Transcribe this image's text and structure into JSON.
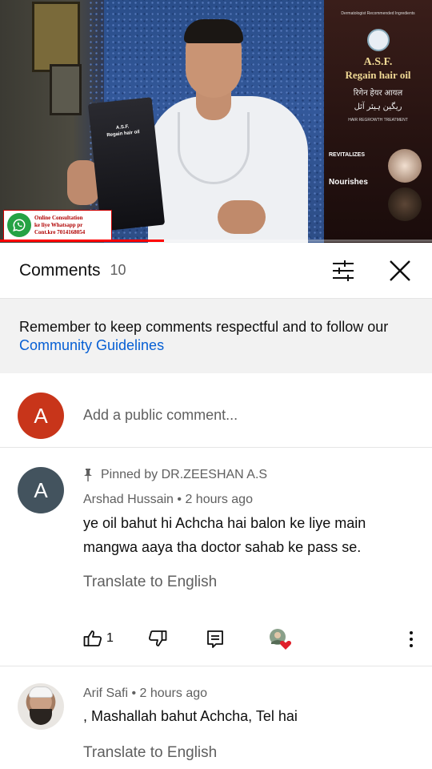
{
  "video": {
    "product_tag": "Dermatologist Recommended Ingredients",
    "product_title": "A.S.F.",
    "product_subtitle": "Regain hair oil",
    "product_hindi": "रिगेन हेयर आयल",
    "product_urdu": "ریگین ہیئر آئل",
    "product_small": "HAIR REGROWTH TREATMENT",
    "product_revitalizes": "REVITALIZES",
    "product_nourishes": "Nourishes",
    "bottle_lines": [
      "A.S.F.",
      "Regain hair oil"
    ],
    "promo_line1": "Online Consultation",
    "promo_line2": "ke liye Whatsapp pr",
    "promo_line3": "Cont.kre 7014168054",
    "progress_fraction": 0.38,
    "accent_color": "#ff0000"
  },
  "header": {
    "title": "Comments",
    "count": "10"
  },
  "notice": {
    "text": "Remember to keep comments respectful and to follow our ",
    "link": "Community Guidelines"
  },
  "add_comment": {
    "avatar_letter": "A",
    "avatar_color": "#c8351a",
    "placeholder": "Add a public comment..."
  },
  "comments": [
    {
      "pinned_label": "Pinned by DR.ZEESHAN A.S",
      "avatar_letter": "A",
      "avatar_color": "#43535e",
      "author": "Arshad Hussain",
      "time": "2 hours ago",
      "text_line1": "ye oil  bahut hi Achcha hai balon ke liye main",
      "text_line2": "mangwa aaya tha doctor sahab ke pass se.",
      "translate": "Translate to English",
      "likes": "1"
    },
    {
      "avatar_icon": "user-photo",
      "author": "Arif Safi",
      "time": "2 hours ago",
      "text_line1": ", Mashallah bahut Achcha, Tel hai",
      "translate": "Translate to English"
    }
  ],
  "separator": " • "
}
